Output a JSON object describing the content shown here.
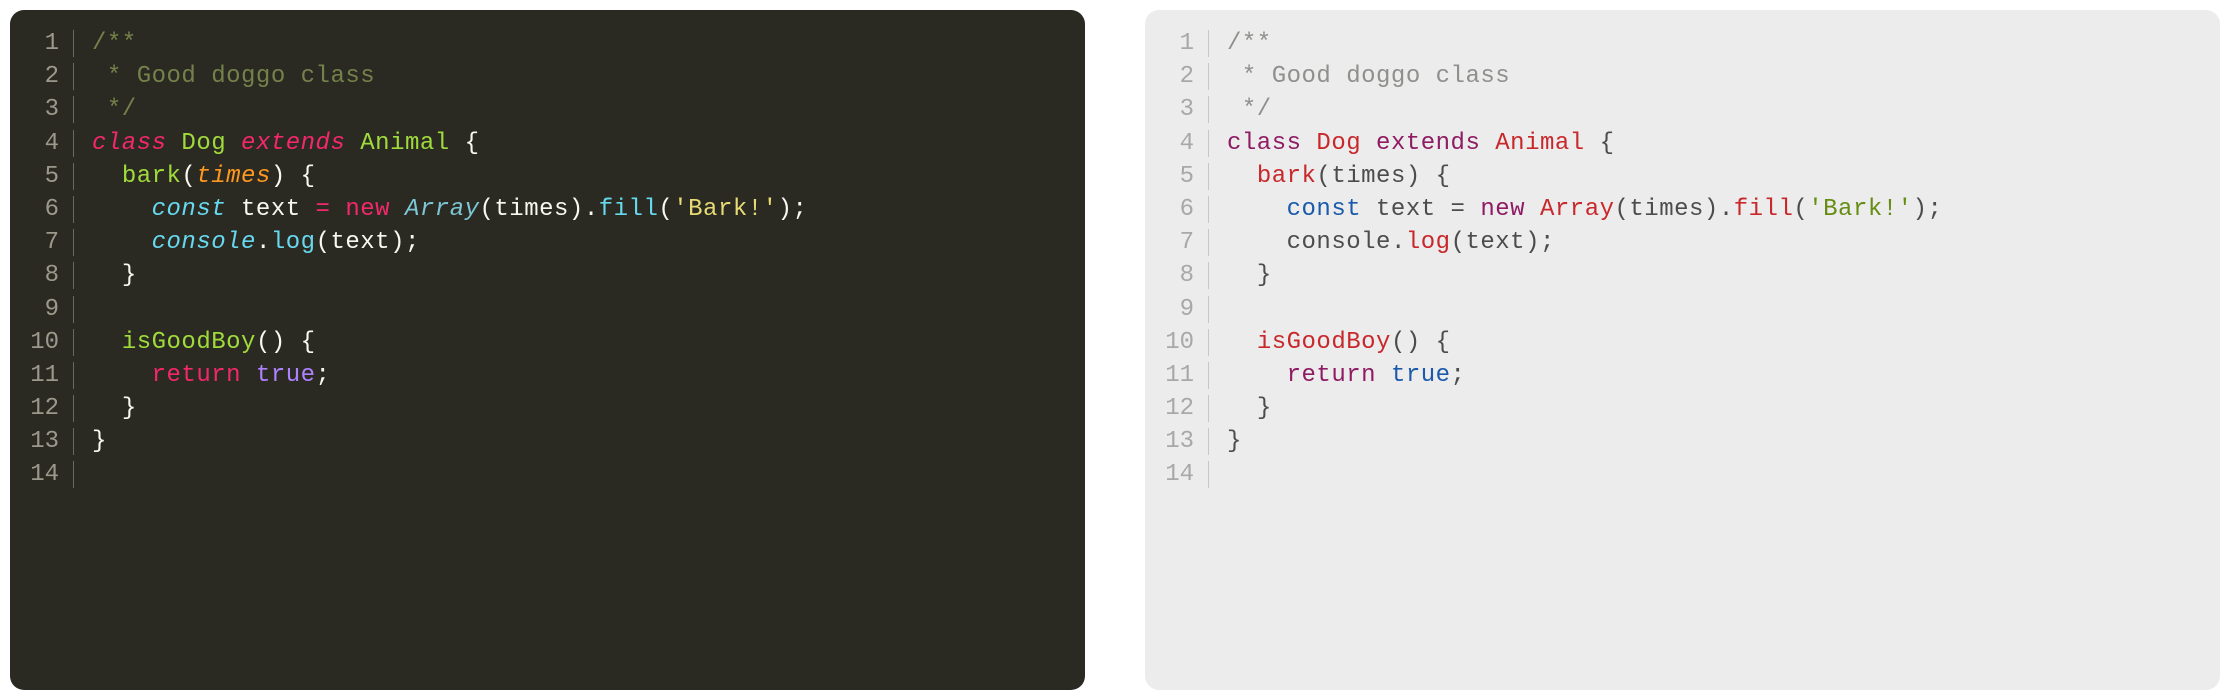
{
  "editors": {
    "dark": {
      "theme": "monokai-like",
      "line_numbers": [
        "1",
        "2",
        "3",
        "4",
        "5",
        "6",
        "7",
        "8",
        "9",
        "10",
        "11",
        "12",
        "13",
        "14"
      ]
    },
    "light": {
      "theme": "light-like",
      "line_numbers": [
        "1",
        "2",
        "3",
        "4",
        "5",
        "6",
        "7",
        "8",
        "9",
        "10",
        "11",
        "12",
        "13",
        "14"
      ]
    }
  },
  "tokens": {
    "comment1": "/**",
    "comment2": " * Good doggo class",
    "comment3": " */",
    "kw_class": "class",
    "id_Dog": "Dog",
    "kw_extends": "extends",
    "id_Animal": "Animal",
    "brace_open": "{",
    "brace_close": "}",
    "fn_bark": "bark",
    "paren_open": "(",
    "paren_close": ")",
    "param_times": "times",
    "kw_const": "const",
    "id_text": "text",
    "op_eq": "=",
    "kw_new": "new",
    "id_Array": "Array",
    "dot": ".",
    "m_fill": "fill",
    "str_bark": "'Bark!'",
    "semi": ";",
    "id_console": "console",
    "m_log": "log",
    "fn_isGoodBoy": "isGoodBoy",
    "kw_return": "return",
    "lit_true": "true",
    "space": " ",
    "indent1": "  ",
    "indent2": "    ",
    "indent3": "      "
  }
}
